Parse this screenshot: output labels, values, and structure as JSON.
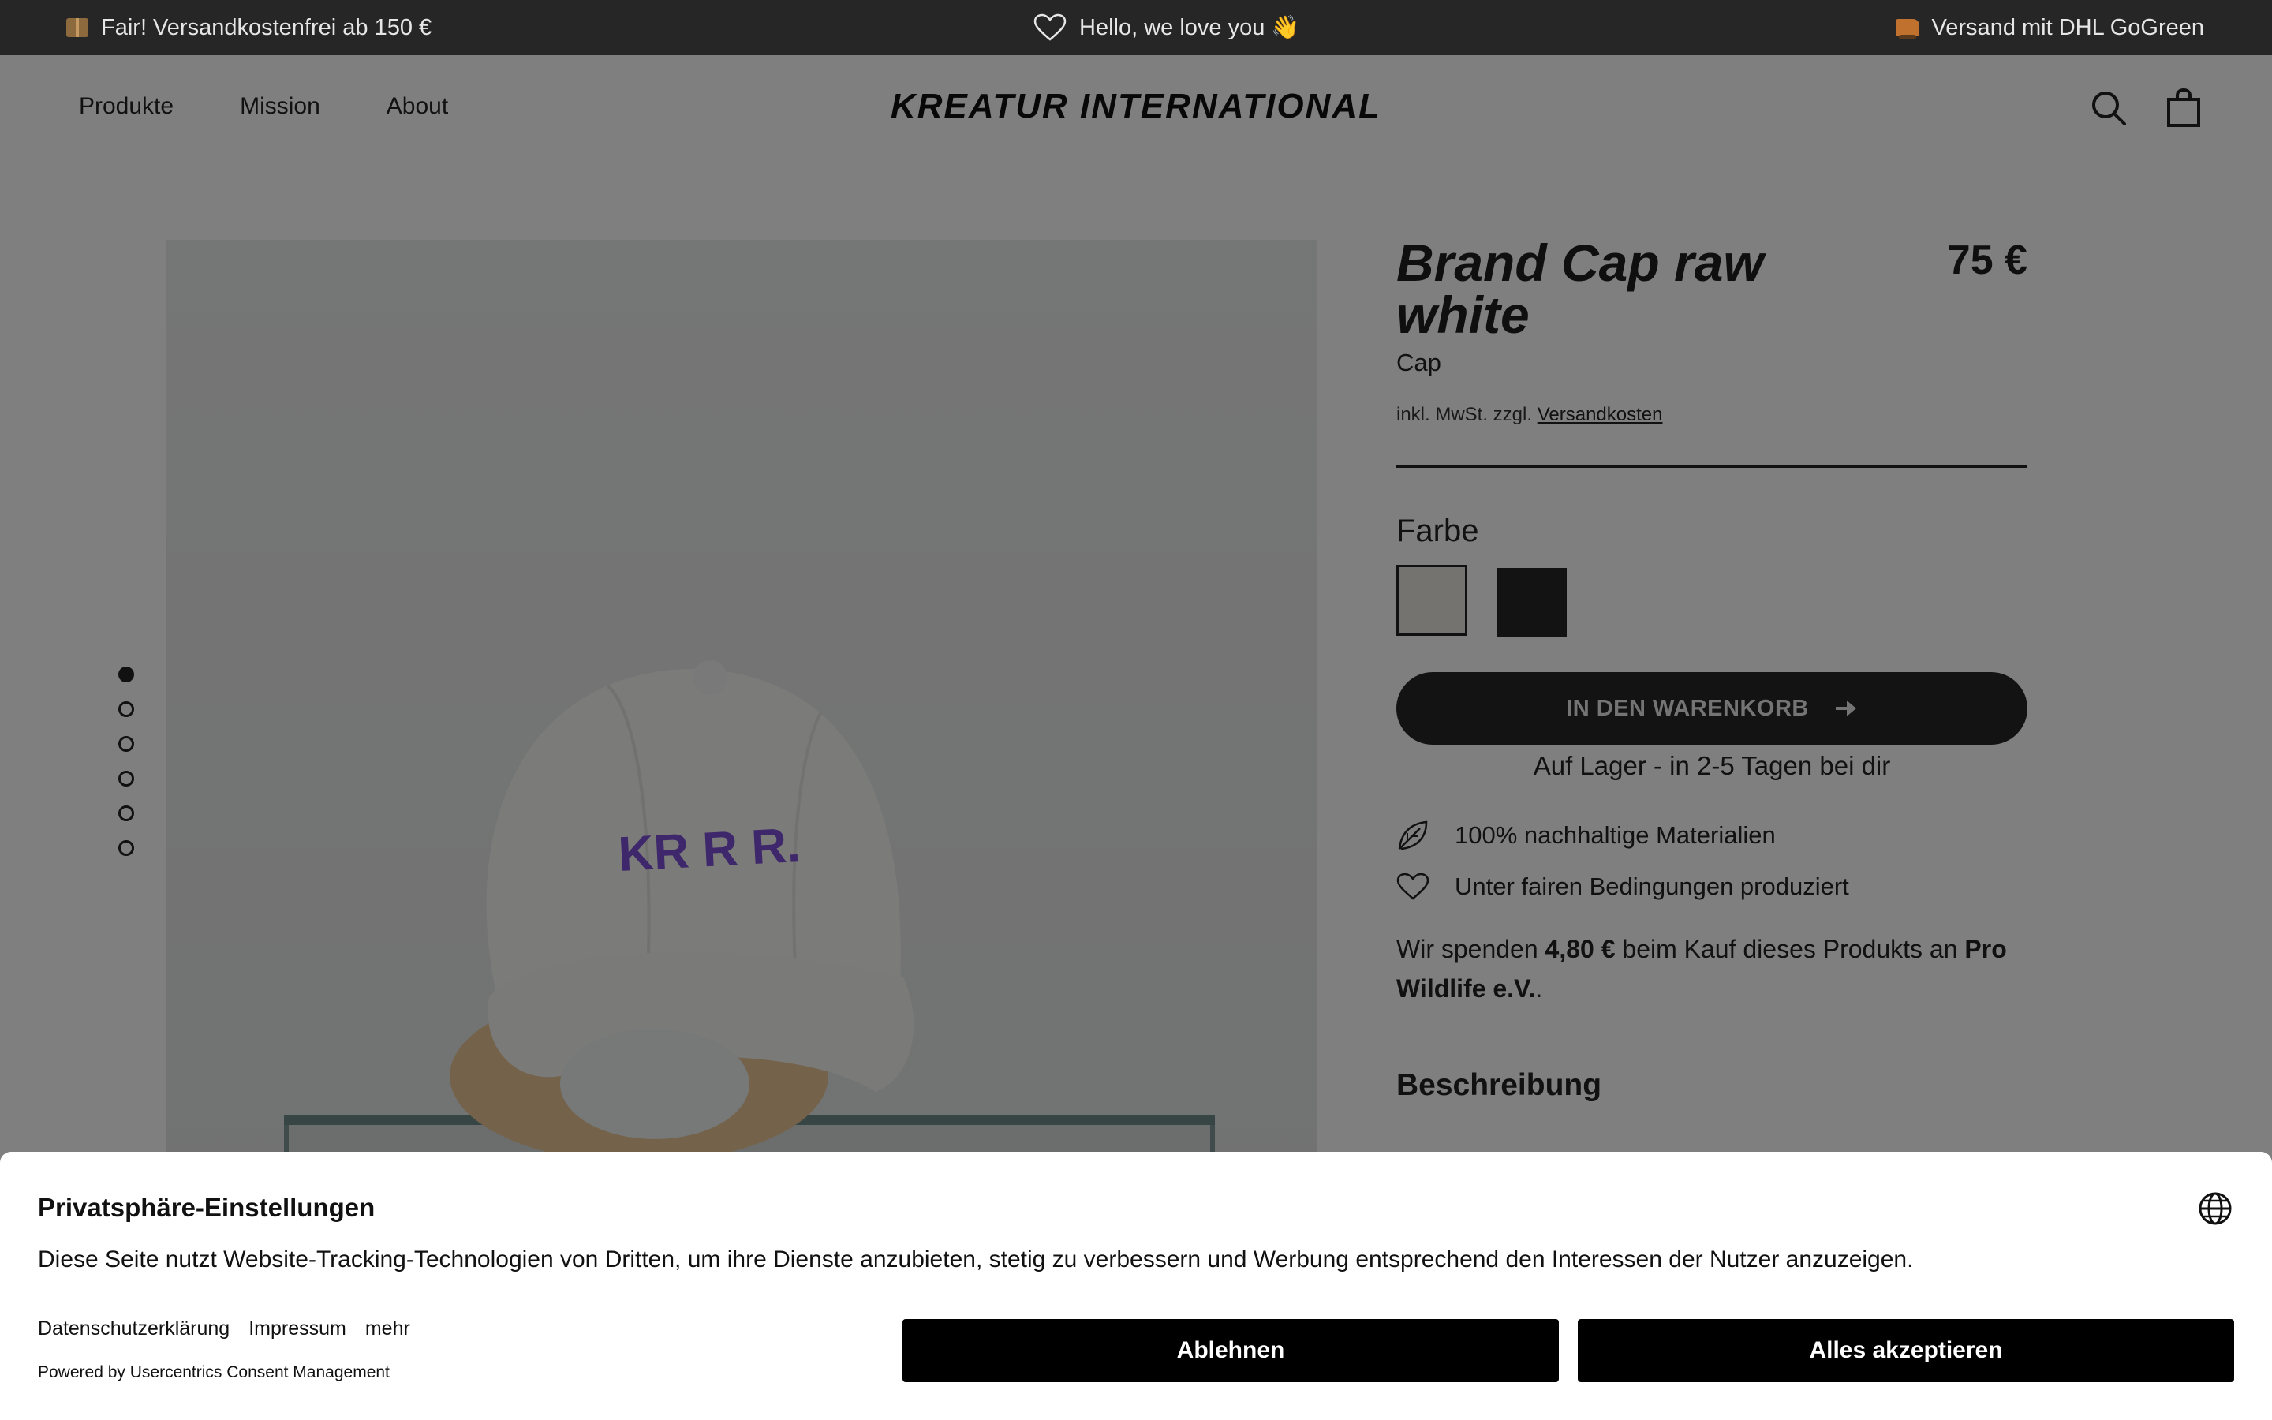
{
  "announcement": {
    "left": "Fair! Versandkostenfrei ab 150 €",
    "center": "Hello, we love you 👋",
    "right": "Versand mit DHL GoGreen"
  },
  "nav": {
    "items": [
      "Produkte",
      "Mission",
      "About"
    ]
  },
  "brand": {
    "logo": "KREATUR INTERNATIONAL"
  },
  "gallery": {
    "slide_count": 6,
    "active_index": 0,
    "cap_text": "KR R  R."
  },
  "product": {
    "title": "Brand Cap raw white",
    "price": "75 €",
    "type": "Cap",
    "tax_note": "inkl. MwSt. zzgl.",
    "shipping_link": "Versandkosten",
    "color_label": "Farbe",
    "swatches": [
      {
        "name": "raw white",
        "color": "#e9e7de",
        "selected": true
      },
      {
        "name": "black",
        "color": "#262626",
        "selected": false
      }
    ],
    "cart_button": "IN DEN WARENKORB",
    "stock": "Auf Lager - in 2-5 Tagen bei dir",
    "features": [
      "100% nachhaltige Materialien",
      "Unter fairen Bedingungen produziert"
    ],
    "donation": {
      "prefix": "Wir spenden",
      "amount": "4,80 €",
      "middle": "beim Kauf dieses Produkts an",
      "org": "Pro Wildlife e.V.",
      "suffix": "."
    },
    "description_heading": "Beschreibung"
  },
  "consent": {
    "title": "Privatsphäre-Einstellungen",
    "text": "Diese Seite nutzt Website-Tracking-Technologien von Dritten, um ihre Dienste anzubieten, stetig zu verbessern und Werbung entsprechend den Interessen der Nutzer anzuzeigen.",
    "links": [
      "Datenschutzerklärung",
      "Impressum",
      "mehr"
    ],
    "powered_by": "Powered by Usercentrics Consent Management",
    "reject_label": "Ablehnen",
    "accept_label": "Alles akzeptieren"
  },
  "colors": {
    "dark": "#262626",
    "overlay": "rgba(0,0,0,0.5)",
    "cap_embroidery": "#7d4fd6"
  }
}
